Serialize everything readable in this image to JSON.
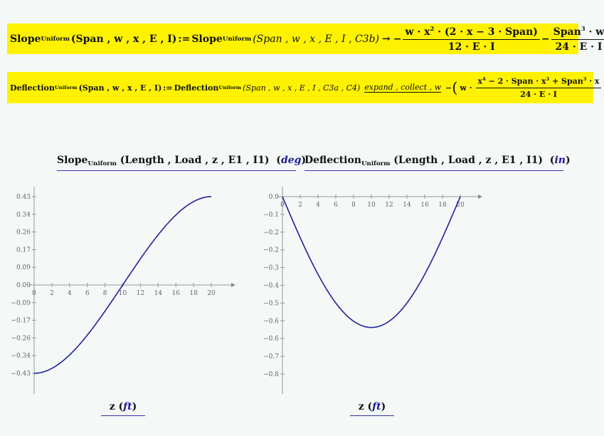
{
  "equations": {
    "slope": {
      "lhs_name": "Slope",
      "lhs_sub": "Uniform",
      "lhs_args": "(Span , w , x , E , I)",
      "define_op": ":=",
      "rhs_name": "Slope",
      "rhs_sub": "Uniform",
      "rhs_args": "(Span , w , x , E , I , C3b)",
      "arrow": "→",
      "minus1": "−",
      "frac1_num": "w · x",
      "frac1_num_sup": "2",
      "frac1_num_rest": " · (2 · x − 3 · Span)",
      "frac1_den": "12 · E · I",
      "minus2": "−",
      "frac2_num": "Span",
      "frac2_num_sup": "3",
      "frac2_num_rest": " · w",
      "frac2_den": "24 · E · I"
    },
    "deflection": {
      "lhs_name": "Deflection",
      "lhs_sub": "Uniform",
      "lhs_args": "(Span , w , x , E , I)",
      "define_op": ":=",
      "rhs_name": "Deflection",
      "rhs_sub": "Uniform",
      "rhs_args": "(Span , w , x , E , I , C3a , C4)",
      "keywords": "expand , collect , w",
      "minus": "−",
      "lparen": "(",
      "w_dot": "w ·",
      "num_a": "x",
      "num_a_sup": "4",
      "num_b": " − 2 · Span · x",
      "num_b_sup": "3",
      "num_c": " + Span",
      "num_c_sup": "3",
      "num_d": " · x",
      "den": "24 · E · I",
      "rparen": ")"
    }
  },
  "chart_data": [
    {
      "type": "line",
      "title_name": "Slope",
      "title_sub": "Uniform",
      "title_args": "(Length , Load , z , E1 , I1)",
      "title_unit": "deg",
      "xlabel": "z",
      "xlabel_unit": "ft",
      "xlim": [
        0,
        21.5
      ],
      "ylim": [
        -0.52,
        0.5
      ],
      "xticks": [
        0,
        2,
        4,
        6,
        8,
        10,
        12,
        14,
        16,
        18,
        20
      ],
      "yticks": [
        0.43,
        0.34,
        0.26,
        0.17,
        0.09,
        0.0,
        -0.09,
        -0.17,
        -0.26,
        -0.34,
        -0.43
      ],
      "ytick_labels": [
        "0.43",
        "0.34",
        "0.26",
        "0.17",
        "0.09",
        "0.00",
        "−0.09",
        "−0.17",
        "−0.26",
        "−0.34",
        "−0.43"
      ],
      "series": [
        {
          "name": "slope",
          "color": "#22229a",
          "function": "slope",
          "x_range": [
            0,
            20
          ],
          "peak": 0.43
        }
      ]
    },
    {
      "type": "line",
      "title_name": "Deflection",
      "title_sub": "Uniform",
      "title_args": "(Length , Load , z , E1 , I1)",
      "title_unit": "in",
      "xlabel": "z",
      "xlabel_unit": "ft",
      "xlim": [
        0,
        21.5
      ],
      "ylim": [
        -0.9,
        0.05
      ],
      "xticks": [
        0,
        2,
        4,
        6,
        8,
        10,
        12,
        14,
        16,
        18,
        20
      ],
      "yticks": [
        0.0,
        -0.1,
        -0.2,
        -0.3,
        -0.4,
        -0.5,
        -0.6,
        -0.7,
        -0.8
      ],
      "ytick_labels": [
        "0.0",
        "−0.1",
        "−0.2",
        "−0.2",
        "−0.3",
        "−0.4",
        "−0.5",
        "−0.6",
        "−0.6",
        "−0.7",
        "−0.8"
      ],
      "series": [
        {
          "name": "deflection",
          "color": "#22229a",
          "function": "deflection",
          "x_range": [
            0,
            20
          ],
          "min": -0.59
        }
      ]
    }
  ]
}
